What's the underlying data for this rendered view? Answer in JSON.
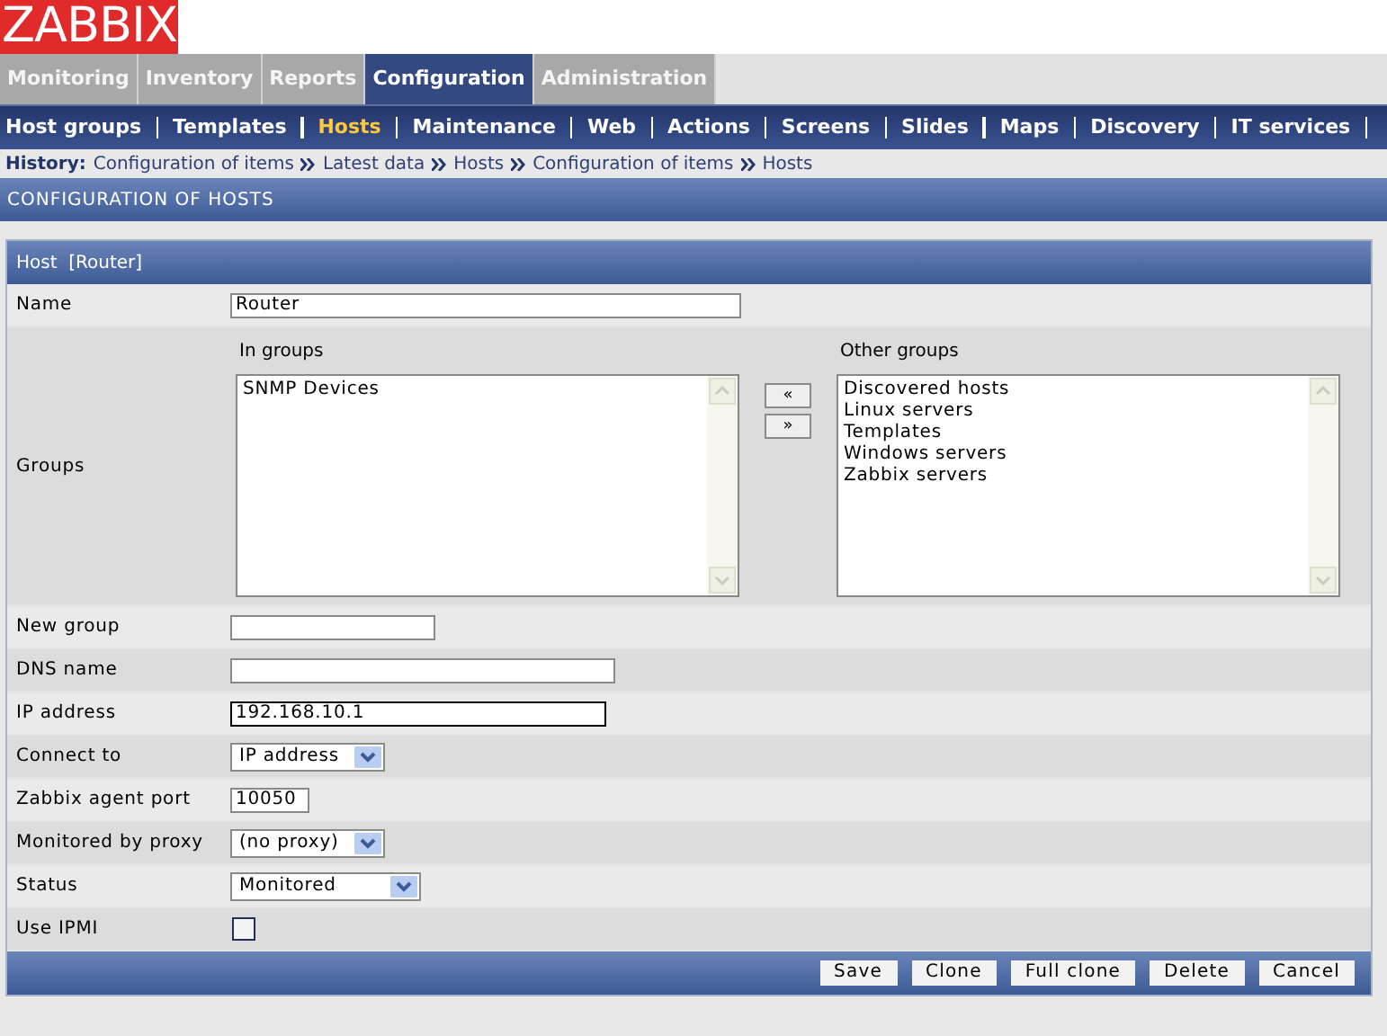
{
  "logo": {
    "text": "ZABBIX"
  },
  "main_menu": [
    {
      "label": "Monitoring",
      "selected": false
    },
    {
      "label": "Inventory",
      "selected": false
    },
    {
      "label": "Reports",
      "selected": false
    },
    {
      "label": "Configuration",
      "selected": true
    },
    {
      "label": "Administration",
      "selected": false
    }
  ],
  "sub_menu": [
    {
      "label": "Host groups",
      "selected": false
    },
    {
      "label": "Templates",
      "selected": false
    },
    {
      "label": "Hosts",
      "selected": true
    },
    {
      "label": "Maintenance",
      "selected": false
    },
    {
      "label": "Web",
      "selected": false
    },
    {
      "label": "Actions",
      "selected": false
    },
    {
      "label": "Screens",
      "selected": false
    },
    {
      "label": "Slides",
      "selected": false
    },
    {
      "label": "Maps",
      "selected": false
    },
    {
      "label": "Discovery",
      "selected": false
    },
    {
      "label": "IT services",
      "selected": false
    }
  ],
  "history": {
    "label": "History:",
    "items": [
      "Configuration of items",
      "Latest data",
      "Hosts",
      "Configuration of items",
      "Hosts"
    ]
  },
  "page_title": "CONFIGURATION OF HOSTS",
  "form": {
    "title": "Host  [Router]",
    "fields": [
      {
        "kind": "text",
        "label": "Name",
        "value": "Router",
        "focused": false
      },
      {
        "kind": "groups",
        "label": "Groups",
        "in_groups": {
          "label": "In groups",
          "items": [
            "SNMP Devices"
          ]
        },
        "move_buttons": [
          "«",
          "»"
        ],
        "other_groups": {
          "label": "Other groups",
          "items": [
            "Discovered hosts",
            "Linux servers",
            "Templates",
            "Windows servers",
            "Zabbix servers"
          ]
        }
      },
      {
        "kind": "text",
        "label": "New group",
        "focused": false
      },
      {
        "kind": "text",
        "label": "DNS name",
        "focused": false
      },
      {
        "kind": "text",
        "label": "IP address",
        "value": "192.168.10.1",
        "focused": true
      },
      {
        "kind": "select",
        "label": "Connect to",
        "value": "IP address"
      },
      {
        "kind": "text",
        "label": "Zabbix agent port",
        "value": "10050",
        "focused": false
      },
      {
        "kind": "select",
        "label": "Monitored by proxy",
        "value": "(no proxy)"
      },
      {
        "kind": "select",
        "label": "Status",
        "value": "Monitored"
      },
      {
        "kind": "checkbox",
        "label": "Use IPMI",
        "checked": false
      }
    ],
    "buttons": [
      "Save",
      "Clone",
      "Full clone",
      "Delete",
      "Cancel"
    ]
  }
}
